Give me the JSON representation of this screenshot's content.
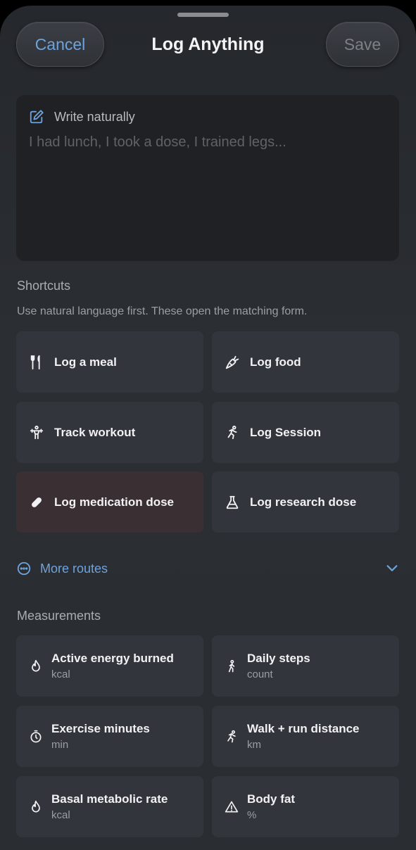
{
  "header": {
    "cancel_label": "Cancel",
    "title": "Log Anything",
    "save_label": "Save"
  },
  "write": {
    "label": "Write naturally",
    "placeholder": "I had lunch, I took a dose, I trained legs...",
    "icon": "compose-icon"
  },
  "shortcuts": {
    "title": "Shortcuts",
    "subtitle": "Use natural language first. These open the matching form.",
    "items": [
      {
        "label": "Log a meal",
        "icon": "fork-knife-icon"
      },
      {
        "label": "Log food",
        "icon": "carrot-icon"
      },
      {
        "label": "Track workout",
        "icon": "weightlifter-icon"
      },
      {
        "label": "Log Session",
        "icon": "runner-icon"
      },
      {
        "label": "Log medication dose",
        "icon": "pill-icon"
      },
      {
        "label": "Log research dose",
        "icon": "flask-icon"
      }
    ]
  },
  "more_routes": {
    "label": "More routes",
    "icon": "ellipsis-circle-icon"
  },
  "measurements": {
    "title": "Measurements",
    "items": [
      {
        "title": "Active energy burned",
        "unit": "kcal",
        "icon": "flame-icon"
      },
      {
        "title": "Daily steps",
        "unit": "count",
        "icon": "walker-icon"
      },
      {
        "title": "Exercise minutes",
        "unit": "min",
        "icon": "timer-icon"
      },
      {
        "title": "Walk + run distance",
        "unit": "km",
        "icon": "runner-icon"
      },
      {
        "title": "Basal metabolic rate",
        "unit": "kcal",
        "icon": "flame-icon"
      },
      {
        "title": "Body fat",
        "unit": "%",
        "icon": "warning-triangle-icon"
      }
    ]
  },
  "colors": {
    "accent": "#6ea3dc",
    "tile": "#32353b",
    "tile_warm": "#3a2f33"
  }
}
